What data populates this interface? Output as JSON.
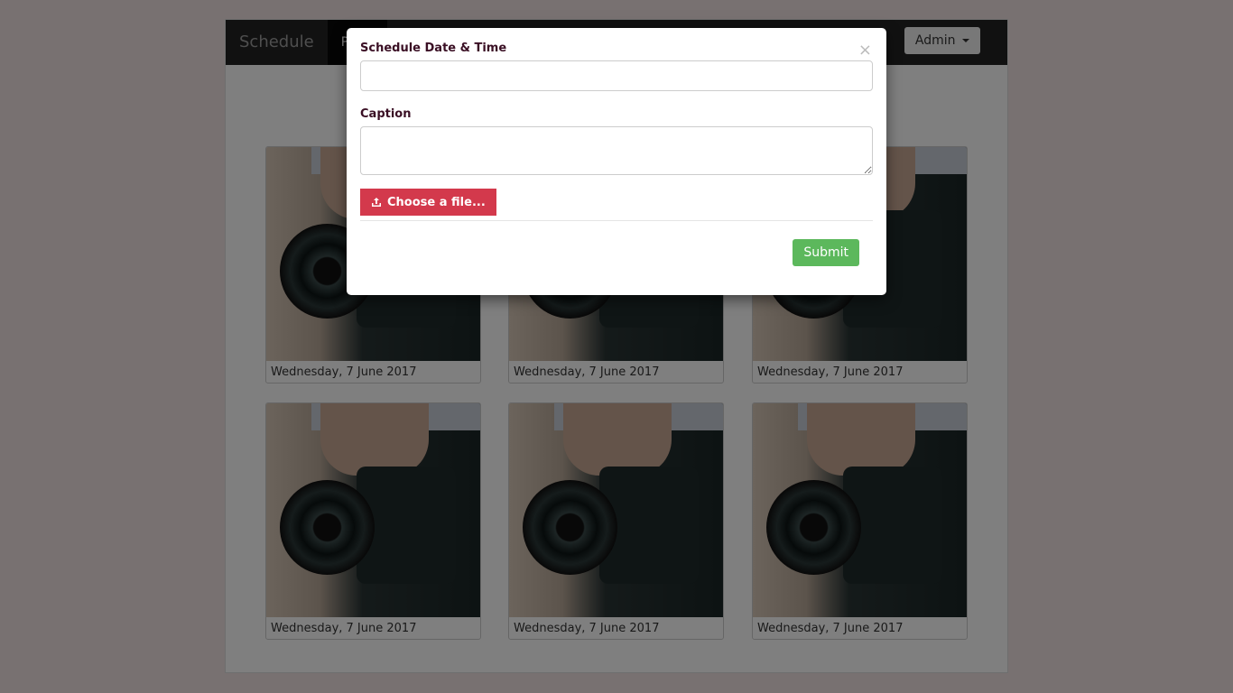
{
  "navbar": {
    "brand": "Schedule",
    "active_item": "Posts",
    "user_menu": "Admin"
  },
  "posts": [
    {
      "date": "Wednesday, 7 June 2017"
    },
    {
      "date": "Wednesday, 7 June 2017"
    },
    {
      "date": "Wednesday, 7 June 2017"
    },
    {
      "date": "Wednesday, 7 June 2017"
    },
    {
      "date": "Wednesday, 7 June 2017"
    },
    {
      "date": "Wednesday, 7 June 2017"
    }
  ],
  "modal": {
    "datetime_label": "Schedule Date & Time",
    "datetime_value": "",
    "caption_label": "Caption",
    "caption_value": "",
    "file_button": "Choose a file...",
    "submit_button": "Submit",
    "close": "×"
  },
  "colors": {
    "file_button": "#d3394c",
    "submit_button": "#5cb85c"
  }
}
